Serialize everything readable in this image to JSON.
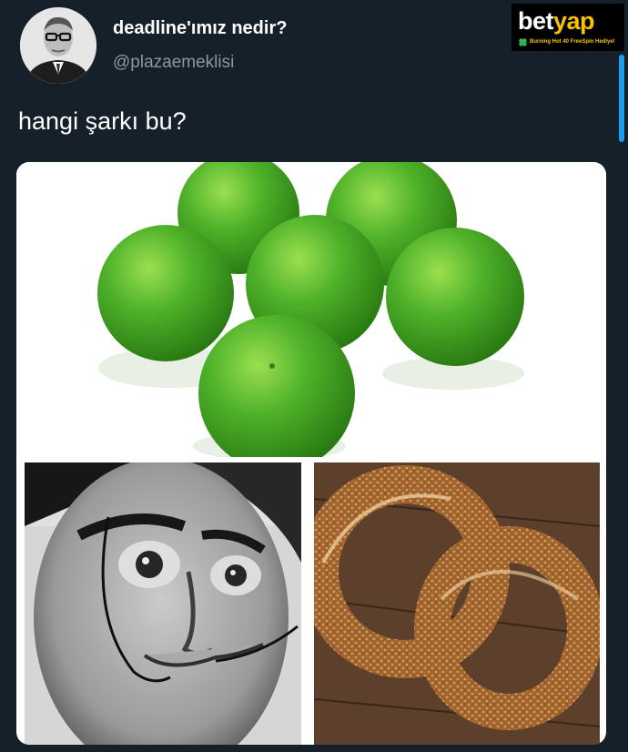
{
  "tweet": {
    "display_name": "deadline'ımız nedir?",
    "handle": "@plazaemeklisi",
    "text": "hangi şarkı bu?"
  },
  "ad_badge": {
    "logo_white": "bet",
    "logo_yellow": "yap",
    "tagline": "Burning Hot 40 FreeSpin Hediye!"
  },
  "colors": {
    "background": "#15202b",
    "handle_gray": "#8899a6",
    "scrollbar_blue": "#1d9bf0",
    "badge_yellow": "#f5c400"
  },
  "media": {
    "panels": [
      "green-plums-photo",
      "mustached-man-photo",
      "simit-bagels-photo"
    ]
  }
}
